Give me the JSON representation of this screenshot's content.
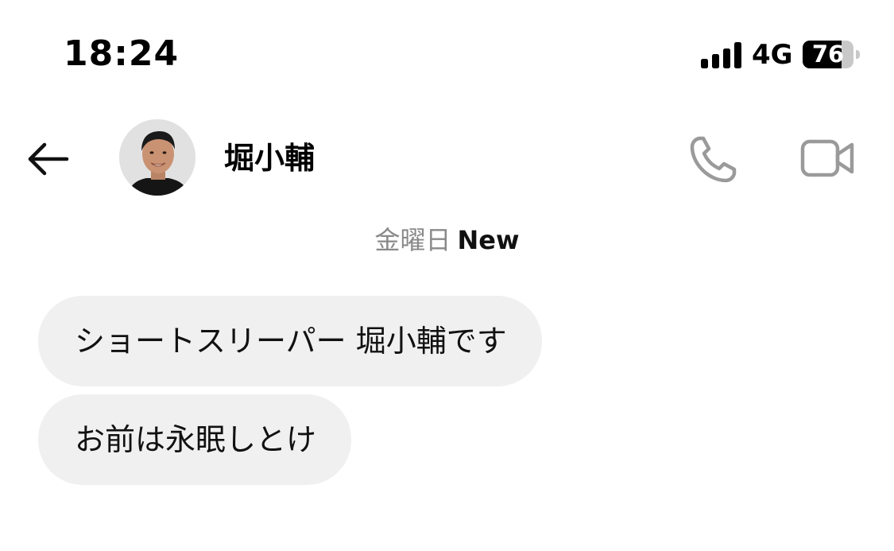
{
  "status_bar": {
    "time": "18:24",
    "network": "4G",
    "battery_level": "76",
    "battery_fraction": 0.76,
    "signal_icon": "cellular-signal-icon",
    "battery_icon": "battery-icon"
  },
  "header": {
    "back_icon": "back-arrow-icon",
    "avatar_icon": "profile-photo",
    "contact_name": "堀小輔",
    "call_icon": "phone-icon",
    "video_icon": "video-camera-icon"
  },
  "day_separator": {
    "day": "金曜日",
    "new_label": "New"
  },
  "messages": [
    {
      "text": "ショートスリーパー 堀小輔です"
    },
    {
      "text": "お前は永眠しとけ"
    }
  ],
  "colors": {
    "bubble_background": "#f0f0f0",
    "icon_gray": "#9a9a9a",
    "day_label_gray": "#8a8a8a"
  }
}
